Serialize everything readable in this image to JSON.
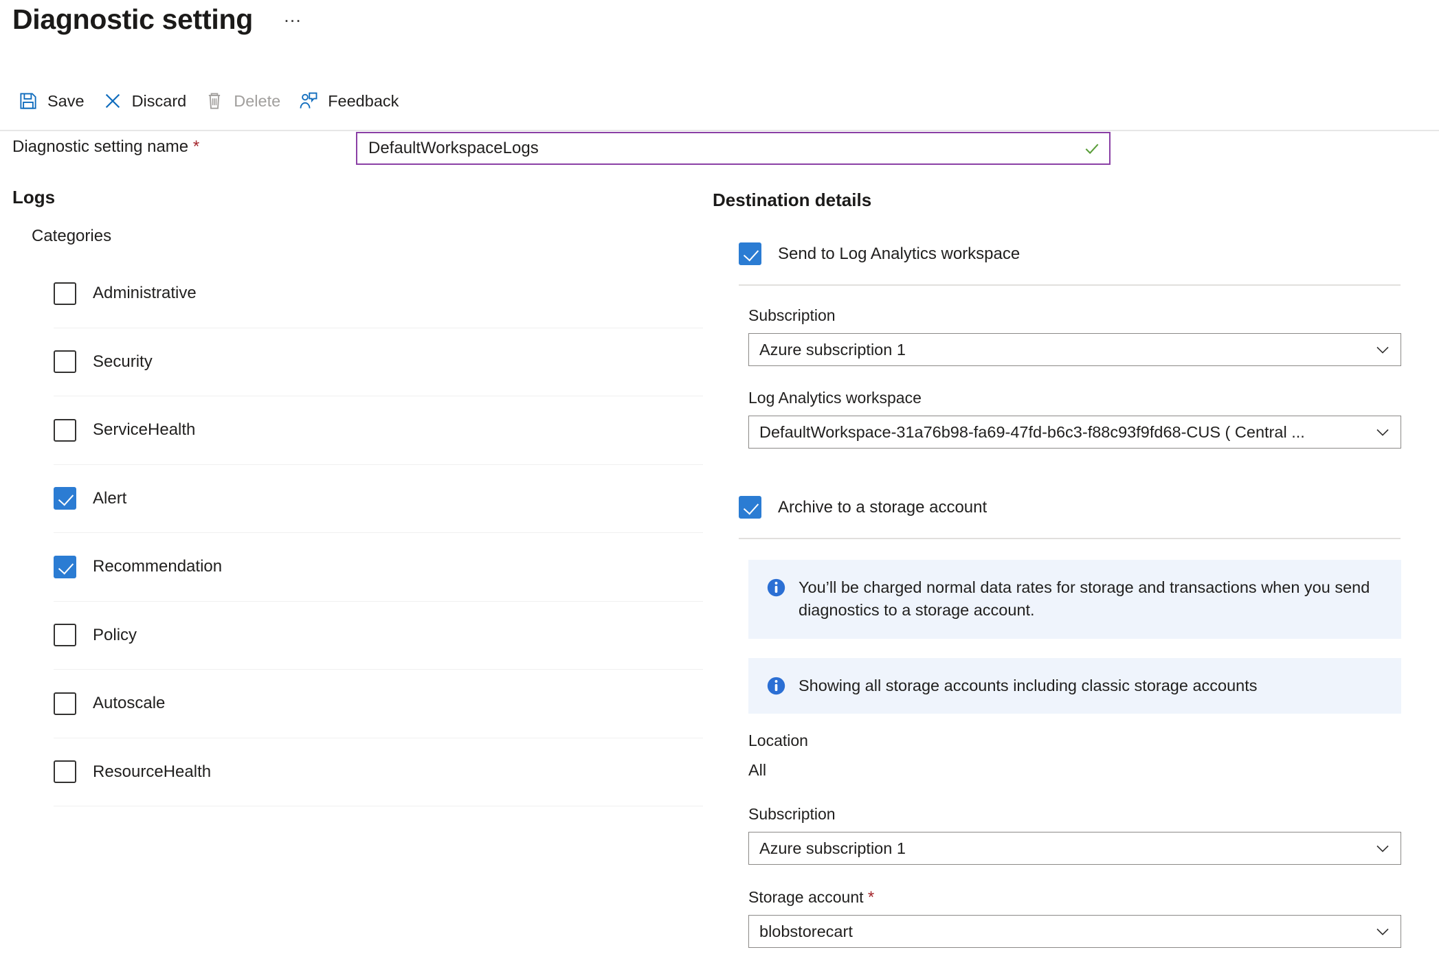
{
  "header": {
    "title": "Diagnostic setting",
    "more_label": "…"
  },
  "toolbar": {
    "save": "Save",
    "discard": "Discard",
    "delete": "Delete",
    "feedback": "Feedback"
  },
  "name_field": {
    "label": "Diagnostic setting name",
    "required_mark": "*",
    "value": "DefaultWorkspaceLogs",
    "placeholder": "",
    "valid": true,
    "border_color": "#8a3fa5",
    "check_color": "#5a9e3a"
  },
  "logs": {
    "section_title": "Logs",
    "categories_title": "Categories",
    "categories": [
      {
        "label": "Administrative",
        "checked": false
      },
      {
        "label": "Security",
        "checked": false
      },
      {
        "label": "ServiceHealth",
        "checked": false
      },
      {
        "label": "Alert",
        "checked": true
      },
      {
        "label": "Recommendation",
        "checked": true
      },
      {
        "label": "Policy",
        "checked": false
      },
      {
        "label": "Autoscale",
        "checked": false
      },
      {
        "label": "ResourceHealth",
        "checked": false
      }
    ]
  },
  "destination": {
    "section_title": "Destination details",
    "log_analytics": {
      "checkbox_label": "Send to Log Analytics workspace",
      "checked": true,
      "subscription_label": "Subscription",
      "subscription_value": "Azure subscription 1",
      "workspace_label": "Log Analytics workspace",
      "workspace_value": "DefaultWorkspace-31a76b98-fa69-47fd-b6c3-f88c93f9fd68-CUS ( Central ..."
    },
    "storage": {
      "checkbox_label": "Archive to a storage account",
      "checked": true,
      "info_1": "You’ll be charged normal data rates for storage and transactions when you send diagnostics to a storage account.",
      "info_2": "Showing all storage accounts including classic storage accounts",
      "location_label": "Location",
      "location_value": "All",
      "subscription_label": "Subscription",
      "subscription_value": "Azure subscription 1",
      "storage_account_label": "Storage account",
      "storage_account_required": "*",
      "storage_account_value": "blobstorecart"
    }
  },
  "colors": {
    "accent_blue": "#2b7cd3",
    "link_blue": "#0f6cbd",
    "info_bg": "#eff4fc",
    "info_icon": "#2b6fd4",
    "required_red": "#a4262c",
    "focus_purple": "#8a3fa5"
  }
}
